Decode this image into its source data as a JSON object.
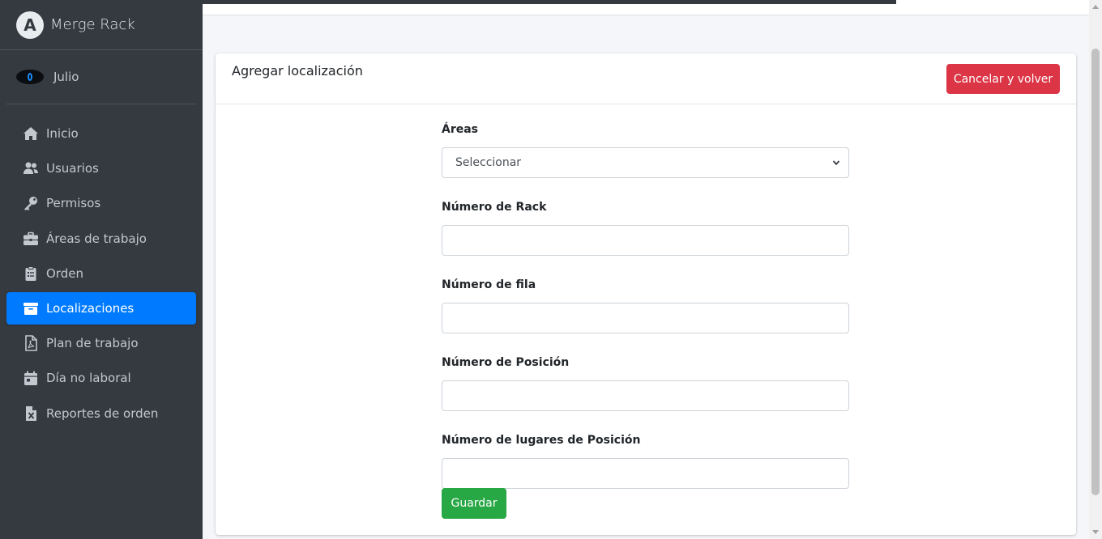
{
  "brand": {
    "name": "Merge Rack",
    "logo_letter": "A"
  },
  "user": {
    "name": "Julio"
  },
  "sidebar": {
    "items": [
      {
        "label": "Inicio",
        "icon": "home-icon"
      },
      {
        "label": "Usuarios",
        "icon": "users-icon"
      },
      {
        "label": "Permisos",
        "icon": "key-icon"
      },
      {
        "label": "Áreas de trabajo",
        "icon": "briefcase-icon"
      },
      {
        "label": "Orden",
        "icon": "clipboard-icon"
      },
      {
        "label": "Localizaciones",
        "icon": "archive-icon",
        "active": true
      },
      {
        "label": "Plan de trabajo",
        "icon": "file-pdf-icon"
      },
      {
        "label": "Día no laboral",
        "icon": "calendar-icon"
      },
      {
        "label": "Reportes de orden",
        "icon": "file-excel-icon"
      }
    ]
  },
  "card": {
    "title": "Agregar localización",
    "cancel_label": "Cancelar y volver"
  },
  "form": {
    "areas": {
      "label": "Áreas",
      "value": "Seleccionar"
    },
    "rack": {
      "label": "Número de Rack",
      "value": ""
    },
    "fila": {
      "label": "Número de fila",
      "value": ""
    },
    "posicion": {
      "label": "Número de Posición",
      "value": ""
    },
    "lugares": {
      "label": "Número de lugares de Posición",
      "value": ""
    },
    "save_label": "Guardar"
  },
  "colors": {
    "sidebar_bg": "#343a40",
    "active": "#007bff",
    "danger": "#dc3545",
    "success": "#28a745"
  }
}
